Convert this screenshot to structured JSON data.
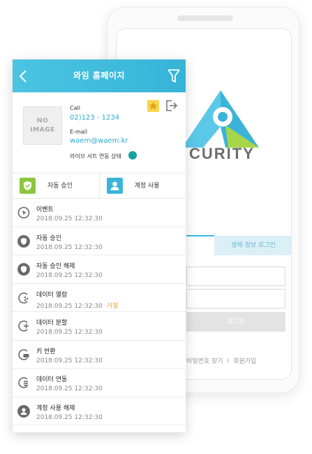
{
  "background_app": {
    "logo_text": "CURITY",
    "tab_bio": "생체 정보 로그인",
    "login_button": "로그인",
    "find_password": "비밀번호 찾기",
    "separator": "I",
    "signup": "회원가입"
  },
  "header": {
    "title": "와임 홈페이지",
    "back_icon": "chevron-left-icon",
    "filter_icon": "filter-icon"
  },
  "profile": {
    "image_placeholder_line1": "NO",
    "image_placeholder_line2": "IMAGE",
    "call_label": "Call",
    "call_value": "02)123 - 1234",
    "email_label": "E-mail",
    "email_value": "waem@waem.kr",
    "live_status": "라이브 서트 연동 상태"
  },
  "actions": [
    {
      "label": "자동 승인",
      "color": "#8cc63f"
    },
    {
      "label": "계정 사용",
      "color": "#3cb4d8"
    }
  ],
  "events": [
    {
      "title": "이벤트",
      "time": "2018.09.25  12:32:30",
      "flag": "",
      "icon": "cursor-icon"
    },
    {
      "title": "자동 승인",
      "time": "2018.09.25  12:32:30",
      "flag": "",
      "icon": "shield-icon"
    },
    {
      "title": "자동 승인 해제",
      "time": "2018.09.25  12:32:30",
      "flag": "",
      "icon": "shield-icon"
    },
    {
      "title": "데이터 열람",
      "time": "2018.09.25  12:32:30",
      "flag": "거절",
      "icon": "data-view-icon"
    },
    {
      "title": "데이터 분할",
      "time": "2018.09.25  12:32:30",
      "flag": "",
      "icon": "data-split-icon"
    },
    {
      "title": "키 반환",
      "time": "2018.09.25  12:32:30",
      "flag": "",
      "icon": "key-return-icon"
    },
    {
      "title": "데이터 연동",
      "time": "2018.09.25  12:32:30",
      "flag": "",
      "icon": "data-link-icon"
    },
    {
      "title": "계정 사용 해제",
      "time": "2018.09.25  12:32:30",
      "flag": "",
      "icon": "user-icon"
    }
  ]
}
